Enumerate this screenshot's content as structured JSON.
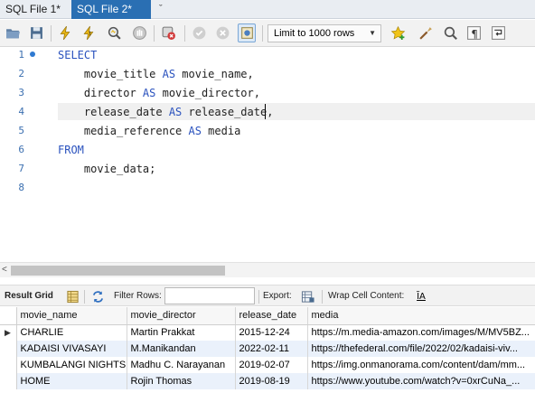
{
  "tabs": [
    {
      "label": "SQL File 1*",
      "active": false
    },
    {
      "label": "SQL File 2*",
      "active": true
    }
  ],
  "tab_more_label": "ˇ",
  "toolbar": {
    "limit_select": "Limit to 1000 rows",
    "icons": [
      "open-folder-icon",
      "save-icon",
      "execute-icon",
      "execute-current-icon",
      "explain-icon",
      "stop-icon",
      "toggle-error-stop-icon",
      "commit-icon",
      "rollback-icon",
      "autocommit-icon",
      "bookmark-star-icon",
      "beautify-icon",
      "find-icon",
      "invisibles-icon",
      "wrap-icon"
    ]
  },
  "editor": {
    "lines": [
      {
        "num": "1",
        "parts": [
          {
            "t": "SELECT",
            "kw": true
          }
        ]
      },
      {
        "num": "2",
        "parts": [
          {
            "t": "    movie_title ",
            "kw": false
          },
          {
            "t": "AS",
            "kw": true
          },
          {
            "t": " movie_name,",
            "kw": false
          }
        ]
      },
      {
        "num": "3",
        "parts": [
          {
            "t": "    director ",
            "kw": false
          },
          {
            "t": "AS",
            "kw": true
          },
          {
            "t": " movie_director,",
            "kw": false
          }
        ]
      },
      {
        "num": "4",
        "parts": [
          {
            "t": "    release_date ",
            "kw": false
          },
          {
            "t": "AS",
            "kw": true
          },
          {
            "t": " release_date,",
            "kw": false
          }
        ]
      },
      {
        "num": "5",
        "parts": [
          {
            "t": "    media_reference ",
            "kw": false
          },
          {
            "t": "AS",
            "kw": true
          },
          {
            "t": " media",
            "kw": false
          }
        ]
      },
      {
        "num": "6",
        "parts": [
          {
            "t": "FROM",
            "kw": true
          }
        ]
      },
      {
        "num": "7",
        "parts": [
          {
            "t": "    movie_data;",
            "kw": false
          }
        ]
      },
      {
        "num": "8",
        "parts": []
      }
    ]
  },
  "result_bar": {
    "result_grid": "Result Grid",
    "filter_rows": "Filter Rows:",
    "filter_value": "",
    "export": "Export:",
    "wrap": "Wrap Cell Content:",
    "wrap_icon_text": "ĨA"
  },
  "grid": {
    "columns": [
      "movie_name",
      "movie_director",
      "release_date",
      "media"
    ],
    "rows": [
      [
        "CHARLIE",
        "Martin Prakkat",
        "2015-12-24",
        "https://m.media-amazon.com/images/M/MV5BZ..."
      ],
      [
        "KADAISI VIVASAYI",
        "M.Manikandan",
        "2022-02-11",
        "https://thefederal.com/file/2022/02/kadaisi-viv..."
      ],
      [
        "KUMBALANGI NIGHTS",
        "Madhu C. Narayanan",
        "2019-02-07",
        "https://img.onmanorama.com/content/dam/mm..."
      ],
      [
        "HOME",
        "Rojin Thomas",
        "2019-08-19",
        "https://www.youtube.com/watch?v=0xrCuNa_..."
      ]
    ],
    "row_marker": "▶"
  }
}
